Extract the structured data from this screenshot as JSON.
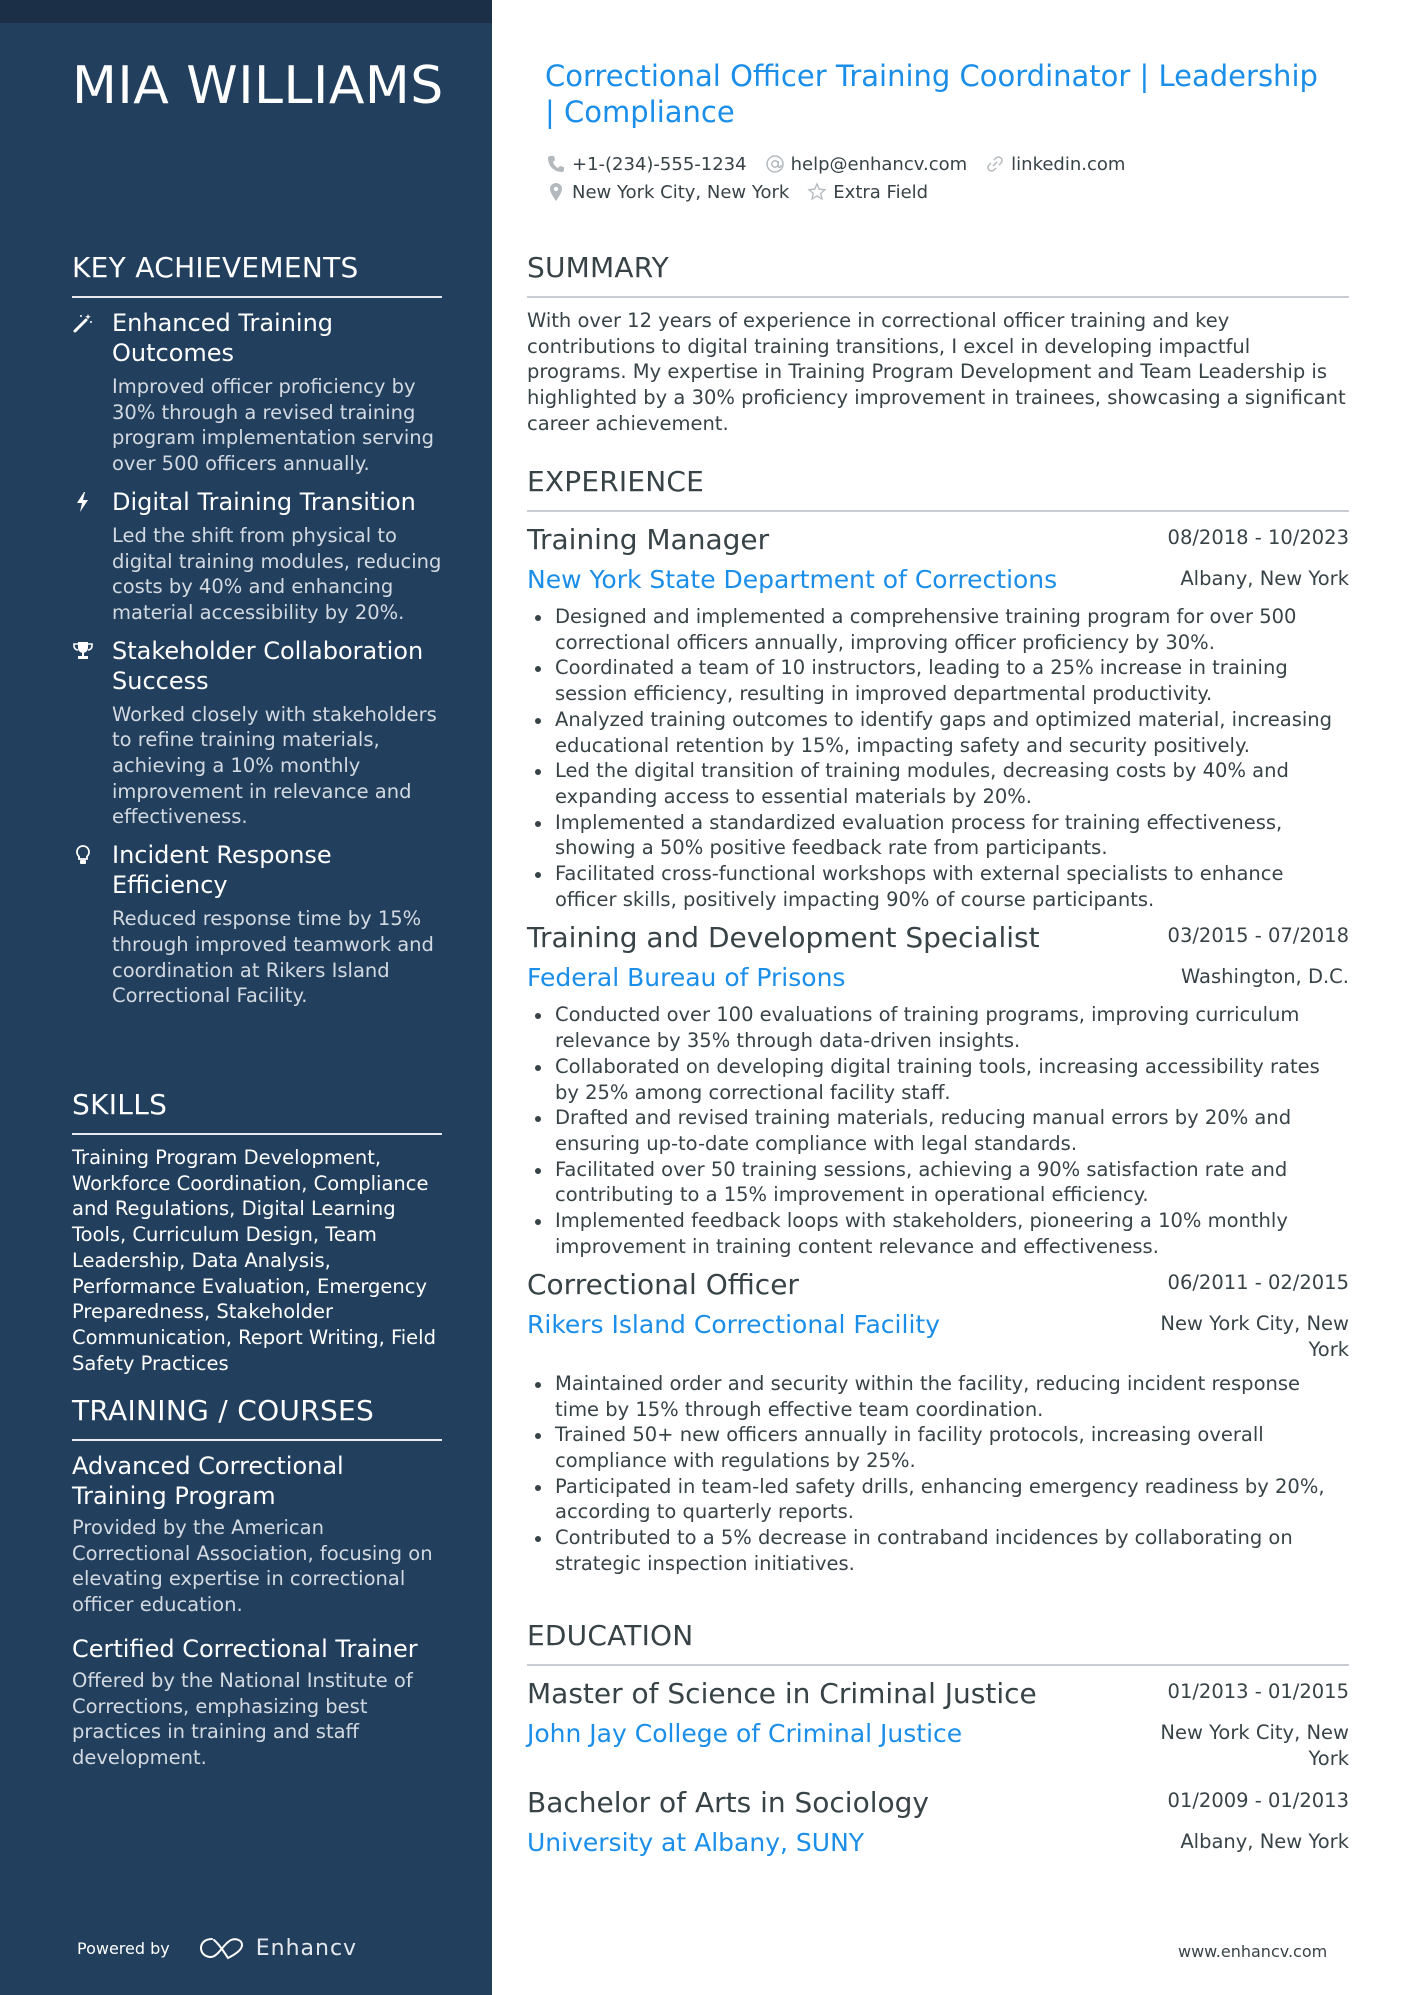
{
  "sidebar": {
    "name": "MIA WILLIAMS",
    "achievements_title": "KEY ACHIEVEMENTS",
    "achievements": [
      {
        "icon": "magic-wand-icon",
        "title": "Enhanced Training Outcomes",
        "desc": "Improved officer proficiency by 30% through a revised training program implementation serving over 500 officers annually."
      },
      {
        "icon": "lightning-bolt-icon",
        "title": "Digital Training Transition",
        "desc": "Led the shift from physical to digital training modules, reducing costs by 40% and enhancing material accessibility by 20%."
      },
      {
        "icon": "trophy-icon",
        "title": "Stakeholder Collaboration Success",
        "desc": "Worked closely with stakeholders to refine training materials, achieving a 10% monthly improvement in relevance and effectiveness."
      },
      {
        "icon": "lightbulb-icon",
        "title": "Incident Response Efficiency",
        "desc": "Reduced response time by 15% through improved teamwork and coordination at Rikers Island Correctional Facility."
      }
    ],
    "skills_title": "SKILLS",
    "skills_text": "Training Program Development, Workforce Coordination, Compliance and Regulations, Digital Learning Tools, Curriculum Design, Team Leadership, Data Analysis, Performance Evaluation, Emergency Preparedness, Stakeholder Communication, Report Writing, Field Safety Practices",
    "courses_title": "TRAINING / COURSES",
    "courses": [
      {
        "title": "Advanced Correctional Training Program",
        "desc": "Provided by the American Correctional Association, focusing on elevating expertise in correctional officer education."
      },
      {
        "title": "Certified Correctional Trainer",
        "desc": "Offered by the National Institute of Corrections, emphasizing best practices in training and staff development."
      }
    ],
    "powered_by": "Powered by",
    "brand": "Enhancv"
  },
  "header": {
    "headline": "Correctional Officer Training Coordinator | Leadership | Compliance",
    "contacts": {
      "phone": "+1-(234)-555-1234",
      "email": "help@enhancv.com",
      "link": "linkedin.com",
      "location": "New York City, New York",
      "extra": "Extra Field"
    }
  },
  "summary": {
    "title": "SUMMARY",
    "text": "With over 12 years of experience in correctional officer training and key contributions to digital training transitions, I excel in developing impactful programs. My expertise in Training Program Development and Team Leadership is highlighted by a 30% proficiency improvement in trainees, showcasing a significant career achievement."
  },
  "experience": {
    "title": "EXPERIENCE",
    "jobs": [
      {
        "title": "Training Manager",
        "dates": "08/2018 - 10/2023",
        "company": "New York State Department of Corrections",
        "location": "Albany, New York",
        "bullets": [
          "Designed and implemented a comprehensive training program for over 500 correctional officers annually, improving officer proficiency by 30%.",
          "Coordinated a team of 10 instructors, leading to a 25% increase in training session efficiency, resulting in improved departmental productivity.",
          "Analyzed training outcomes to identify gaps and optimized material, increasing educational retention by 15%, impacting safety and security positively.",
          "Led the digital transition of training modules, decreasing costs by 40% and expanding access to essential materials by 20%.",
          "Implemented a standardized evaluation process for training effectiveness, showing a 50% positive feedback rate from participants.",
          "Facilitated cross-functional workshops with external specialists to enhance officer skills, positively impacting 90% of course participants."
        ]
      },
      {
        "title": "Training and Development Specialist",
        "dates": "03/2015 - 07/2018",
        "company": "Federal Bureau of Prisons",
        "location": "Washington, D.C.",
        "bullets": [
          "Conducted over 100 evaluations of training programs, improving curriculum relevance by 35% through data-driven insights.",
          "Collaborated on developing digital training tools, increasing accessibility rates by 25% among correctional facility staff.",
          "Drafted and revised training materials, reducing manual errors by 20% and ensuring up-to-date compliance with legal standards.",
          "Facilitated over 50 training sessions, achieving a 90% satisfaction rate and contributing to a 15% improvement in operational efficiency.",
          "Implemented feedback loops with stakeholders, pioneering a 10% monthly improvement in training content relevance and effectiveness."
        ]
      },
      {
        "title": "Correctional Officer",
        "dates": "06/2011 - 02/2015",
        "company": "Rikers Island Correctional Facility",
        "location": "New York City, New York",
        "bullets": [
          "Maintained order and security within the facility, reducing incident response time by 15% through effective team coordination.",
          "Trained 50+ new officers annually in facility protocols, increasing overall compliance with regulations by 25%.",
          "Participated in team-led safety drills, enhancing emergency readiness by 20%, according to quarterly reports.",
          "Contributed to a 5% decrease in contraband incidences by collaborating on strategic inspection initiatives."
        ]
      }
    ]
  },
  "education": {
    "title": "EDUCATION",
    "items": [
      {
        "degree": "Master of Science in Criminal Justice",
        "dates": "01/2013 - 01/2015",
        "school": "John Jay College of Criminal Justice",
        "location": "New York City, New York"
      },
      {
        "degree": "Bachelor of Arts in Sociology",
        "dates": "01/2009 - 01/2013",
        "school": "University at Albany, SUNY",
        "location": "Albany, New York"
      }
    ]
  },
  "footer": {
    "url": "www.enhancv.com"
  },
  "colors": {
    "sidebar_bg": "#22405e",
    "accent": "#1a8ee8",
    "text": "#384347"
  }
}
